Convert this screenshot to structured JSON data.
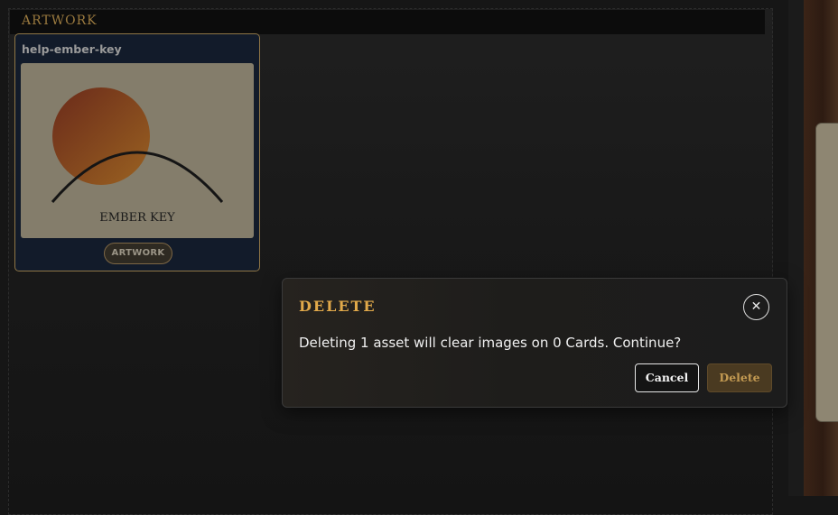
{
  "section": {
    "title": "ARTWORK"
  },
  "asset": {
    "name": "help-ember-key",
    "thumbnail_caption": "EMBER KEY",
    "type_badge": "ARTWORK"
  },
  "dialog": {
    "title": "DELETE",
    "message": "Deleting 1 asset will clear images on 0 Cards. Continue?",
    "close_icon": "close-icon",
    "cancel_label": "Cancel",
    "delete_label": "Delete"
  },
  "colors": {
    "accent_gold": "#e1a94a",
    "card_border": "#8f7646",
    "delete_button_bg": "#4a3a21"
  }
}
